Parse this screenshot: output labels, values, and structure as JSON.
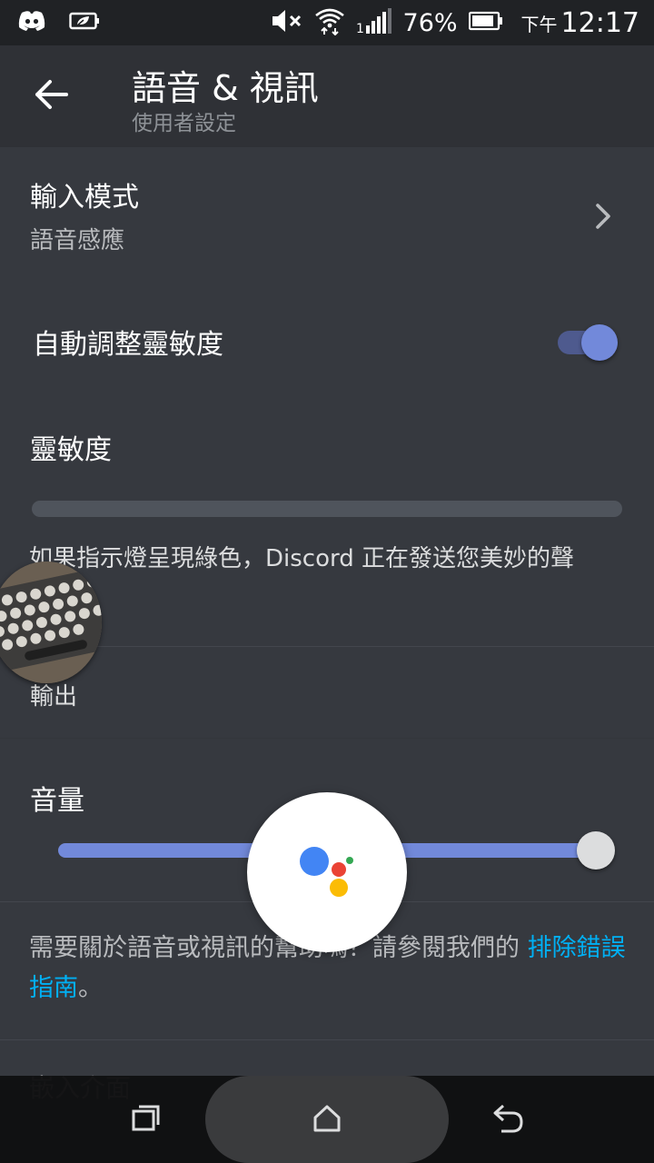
{
  "status_bar": {
    "battery_percent": "76%",
    "ampm": "下午",
    "time": "12:17",
    "left_icons": [
      "discord-icon",
      "leaf-battery-saver-icon"
    ],
    "right_icons": [
      "mute-icon",
      "wifi-icon",
      "signal-icon",
      "battery-icon"
    ]
  },
  "header": {
    "title": "語音 & 視訊",
    "subtitle": "使用者設定",
    "back_icon": "arrow-left-icon"
  },
  "settings": {
    "input_mode": {
      "title": "輸入模式",
      "value": "語音感應"
    },
    "auto_sensitivity": {
      "label": "自動調整靈敏度",
      "enabled": true
    },
    "sensitivity": {
      "label": "靈敏度"
    },
    "hint": "如果指示燈呈現綠色，Discord 正在發送您美妙的聲音。",
    "output_section": "輸出",
    "volume": {
      "label": "音量",
      "level_fraction": 0.96
    },
    "help_text": "需要關於語音或視訊的幫助嗎？請參閱我們的",
    "help_link": "排除錯誤指南",
    "help_end": "。",
    "embed_row": "嵌入介面"
  },
  "colors": {
    "background": "#36393f",
    "header": "#2f3136",
    "accent": "#7289da",
    "link": "#00b0f4"
  },
  "overlays": {
    "assistant_button": "google-assistant-icon",
    "chat_head": "keyboard-photo-bubble"
  },
  "nav_bar": {
    "icons": [
      "recent-apps-icon",
      "home-icon",
      "back-icon"
    ]
  }
}
